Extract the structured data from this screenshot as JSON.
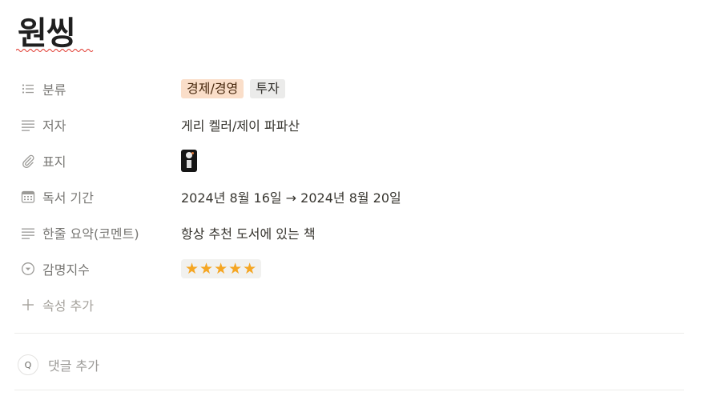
{
  "page": {
    "title": "원씽"
  },
  "properties": [
    {
      "label": "분류",
      "icon": "list-icon",
      "tags": [
        "경제/경영",
        "투자"
      ]
    },
    {
      "label": "저자",
      "icon": "text-icon",
      "value": "게리 켈러/제이 파파산"
    },
    {
      "label": "표지",
      "icon": "paperclip-icon",
      "value_type": "file-thumbnail"
    },
    {
      "label": "독서 기간",
      "icon": "calendar-icon",
      "value": "2024년 8월 16일 → 2024년 8월 20일"
    },
    {
      "label": "한줄 요약(코멘트)",
      "icon": "text-icon",
      "value": "항상 추천 도서에 있는 책"
    },
    {
      "label": "감명지수",
      "icon": "select-icon",
      "value": "★★★★★",
      "rating": 5,
      "max_rating": 5
    }
  ],
  "add_property": {
    "label": "속성 추가"
  },
  "comment": {
    "placeholder": "댓글 추가",
    "avatar_initial": "Q"
  },
  "colors": {
    "tag_orange": "#fadec9",
    "tag_gray": "#ebebea",
    "star": "#f5a623"
  }
}
